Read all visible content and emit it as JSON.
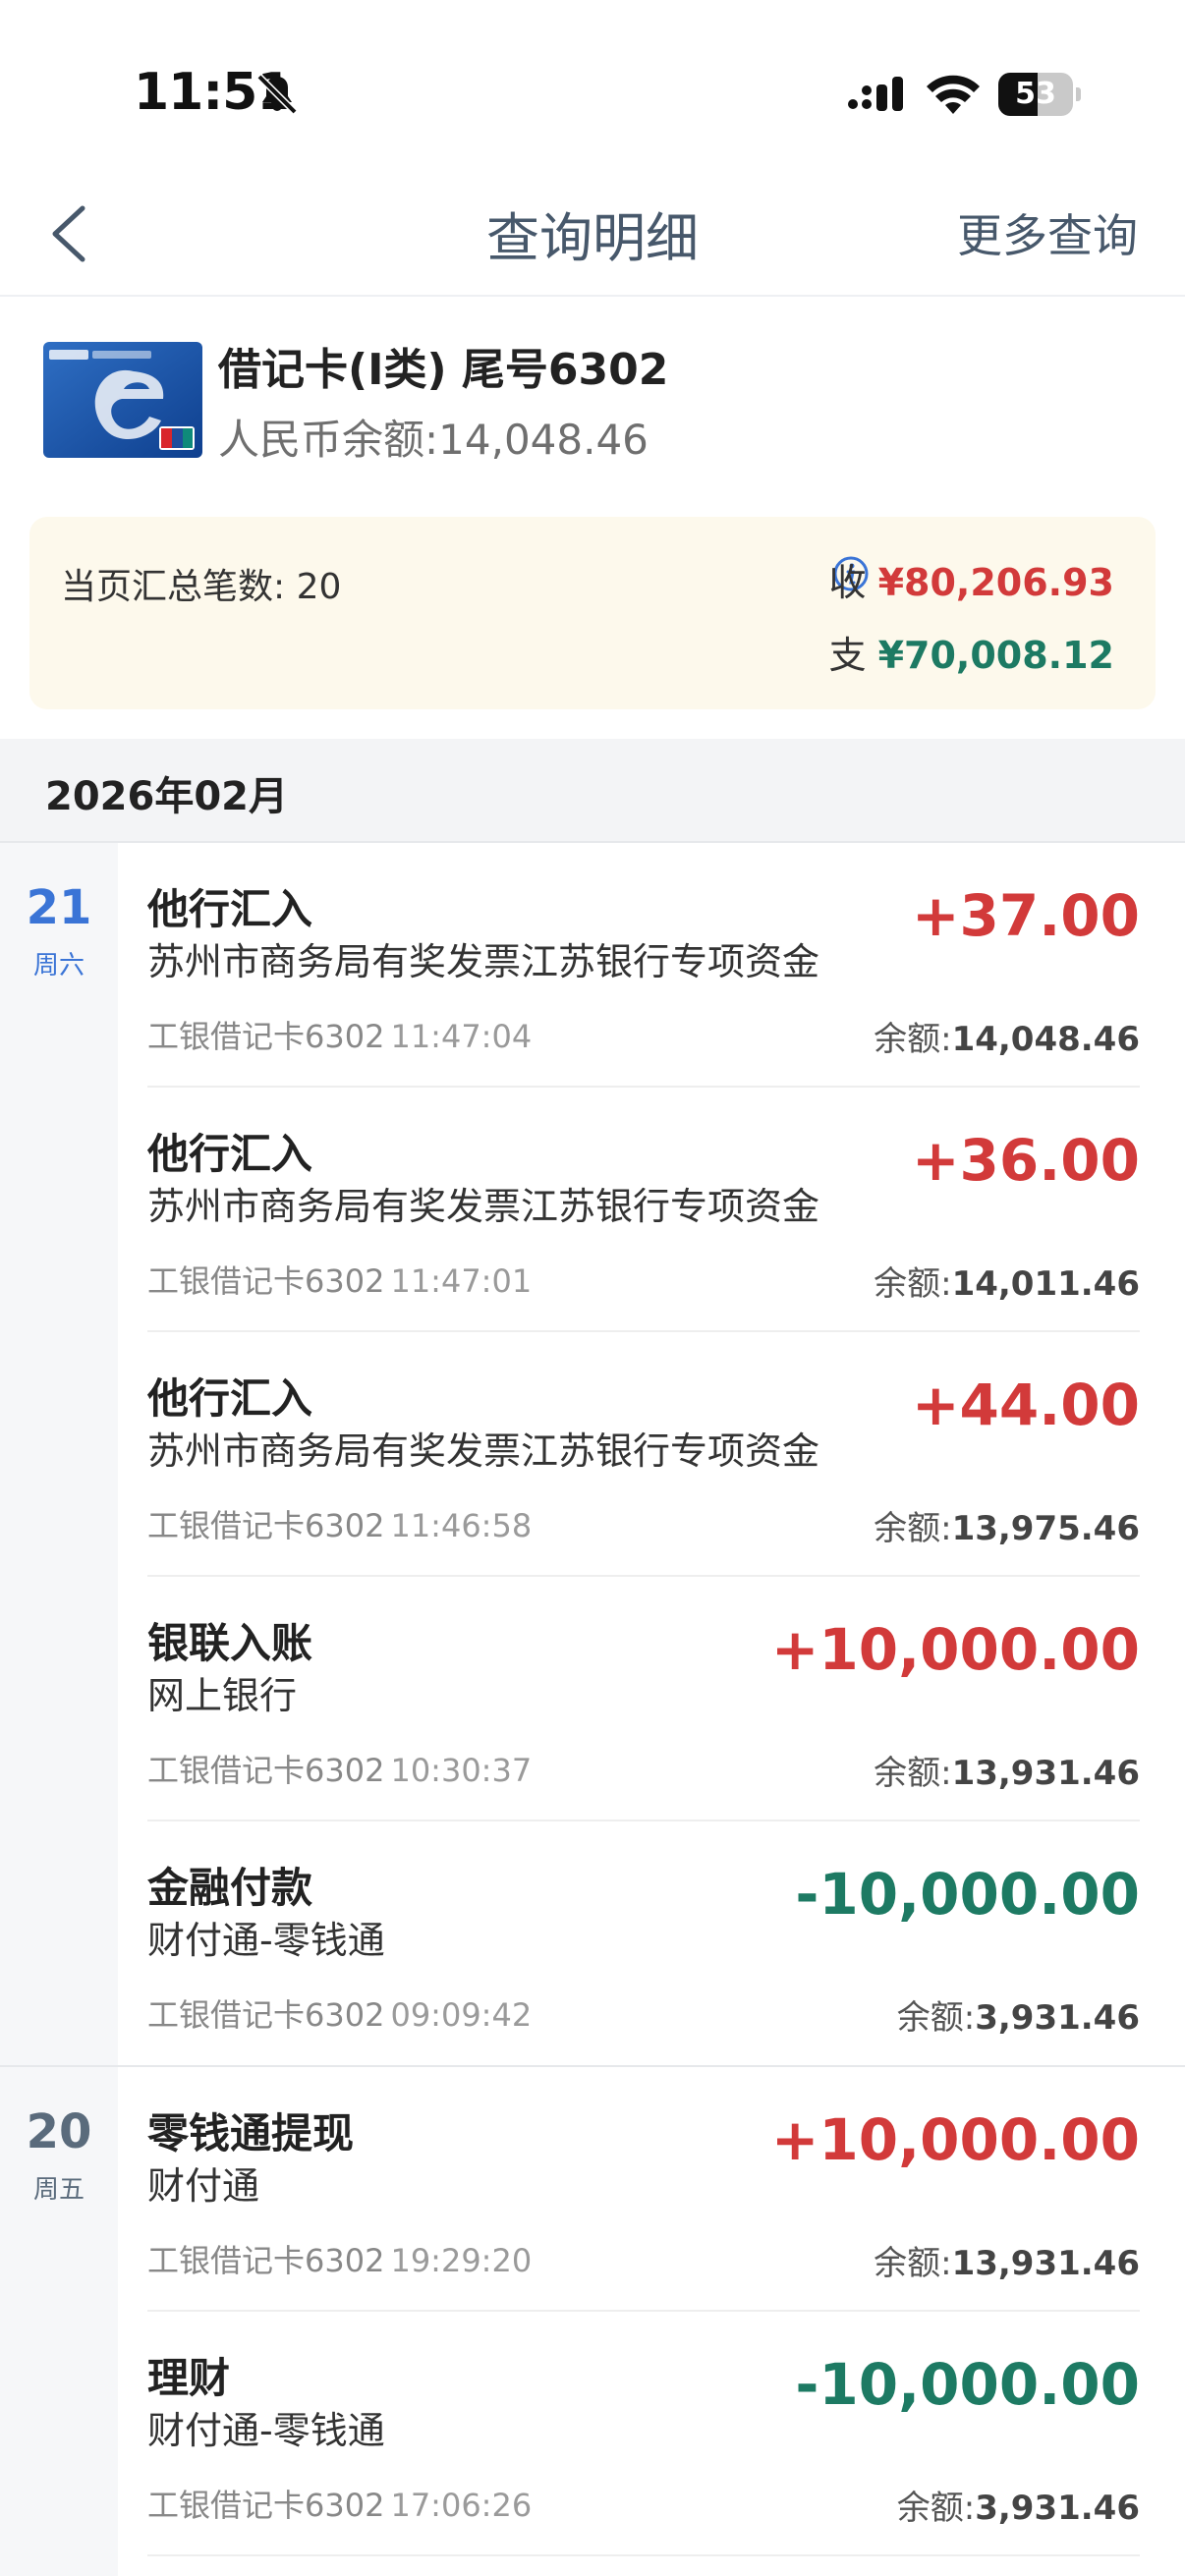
{
  "status_bar": {
    "time": "11:51",
    "battery": "53",
    "battery_level": 0.53
  },
  "nav": {
    "title": "查询明细",
    "more": "更多查询"
  },
  "account": {
    "name": "借记卡(I类) 尾号6302",
    "balance": "人民币余额:14,048.46"
  },
  "summary": {
    "count_label": "当页汇总笔数: 20",
    "income_label": "收",
    "income_amount": "¥80,206.93",
    "expense_label": "支",
    "expense_amount": "¥70,008.12"
  },
  "month": "2026年02月",
  "days": [
    {
      "day": "21",
      "weekday": "周六",
      "transactions": [
        {
          "type": "他行汇入",
          "desc": "苏州市商务局有奖发票江苏银行专项资金",
          "card": "工银借记卡6302",
          "time": "11:47:04",
          "amount": "+37.00",
          "direction": "in",
          "balance_label": "余额:",
          "balance": "14,048.46"
        },
        {
          "type": "他行汇入",
          "desc": "苏州市商务局有奖发票江苏银行专项资金",
          "card": "工银借记卡6302",
          "time": "11:47:01",
          "amount": "+36.00",
          "direction": "in",
          "balance_label": "余额:",
          "balance": "14,011.46"
        },
        {
          "type": "他行汇入",
          "desc": "苏州市商务局有奖发票江苏银行专项资金",
          "card": "工银借记卡6302",
          "time": "11:46:58",
          "amount": "+44.00",
          "direction": "in",
          "balance_label": "余额:",
          "balance": "13,975.46"
        },
        {
          "type": "银联入账",
          "desc": "网上银行",
          "card": "工银借记卡6302",
          "time": "10:30:37",
          "amount": "+10,000.00",
          "direction": "in",
          "balance_label": "余额:",
          "balance": "13,931.46"
        },
        {
          "type": "金融付款",
          "desc": "财付通-零钱通",
          "card": "工银借记卡6302",
          "time": "09:09:42",
          "amount": "-10,000.00",
          "direction": "out",
          "balance_label": "余额:",
          "balance": "3,931.46"
        }
      ]
    },
    {
      "day": "20",
      "weekday": "周五",
      "transactions": [
        {
          "type": "零钱通提现",
          "desc": "财付通",
          "card": "工银借记卡6302",
          "time": "19:29:20",
          "amount": "+10,000.00",
          "direction": "in",
          "balance_label": "余额:",
          "balance": "13,931.46"
        },
        {
          "type": "理财",
          "desc": "财付通-零钱通",
          "card": "工银借记卡6302",
          "time": "17:06:26",
          "amount": "-10,000.00",
          "direction": "out",
          "balance_label": "余额:",
          "balance": "3,931.46"
        }
      ]
    }
  ],
  "colors": {
    "income": "#d23a3a",
    "expense": "#1d7a63",
    "day_active": "#3a74d6",
    "nav_text": "#47586b"
  }
}
